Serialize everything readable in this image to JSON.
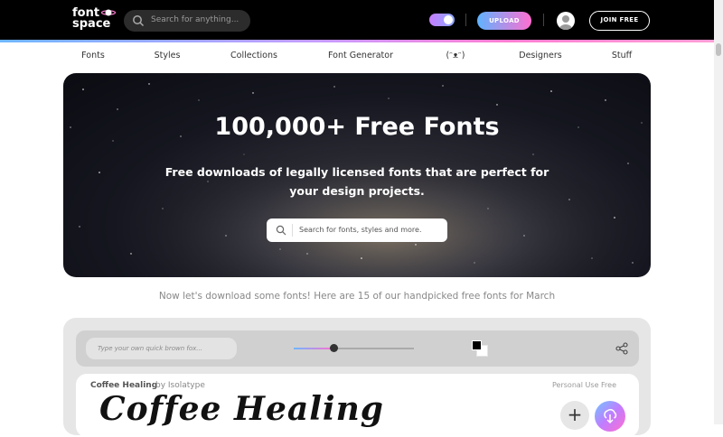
{
  "header": {
    "logo": {
      "line1": "font",
      "line2": "space"
    },
    "search_placeholder": "Search for anything...",
    "upload_label": "UPLOAD",
    "join_label": "JOIN FREE"
  },
  "nav": {
    "items": [
      {
        "label": "Fonts"
      },
      {
        "label": "Styles"
      },
      {
        "label": "Collections"
      },
      {
        "label": "Font Generator"
      },
      {
        "label": "(ᵔᴥᵔ)"
      },
      {
        "label": "Designers"
      },
      {
        "label": "Stuff"
      }
    ]
  },
  "hero": {
    "title": "100,000+ Free Fonts",
    "subtitle": "Free downloads of legally licensed fonts that are perfect for your design projects.",
    "search_placeholder": "Search for fonts, styles and more."
  },
  "tagline": "Now let's download some fonts! Here are 15 of our handpicked free fonts for March",
  "toolbar": {
    "quick_placeholder": "Type your own quick brown fox...",
    "size_level": 0.33
  },
  "font_card": {
    "name": "Coffee Healing",
    "by_label": "by Isolatype",
    "license": "Personal Use Free",
    "preview_text": "Coffee Healing",
    "add_label": "+"
  },
  "colors": {
    "accent_gradient_start": "#5fb3ff",
    "accent_gradient_end": "#ff6fd0",
    "topbar": "#000000"
  }
}
